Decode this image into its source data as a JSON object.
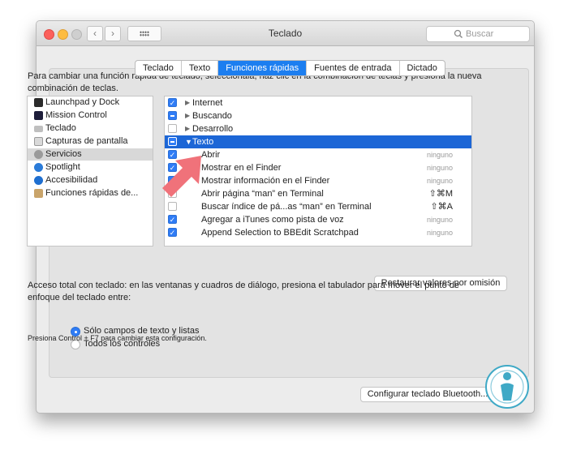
{
  "window": {
    "title": "Teclado"
  },
  "toolbar": {
    "back_glyph": "‹",
    "forward_glyph": "›"
  },
  "search": {
    "placeholder": "Buscar"
  },
  "tabs": [
    {
      "label": "Teclado",
      "active": false
    },
    {
      "label": "Texto",
      "active": false
    },
    {
      "label": "Funciones rápidas",
      "active": true
    },
    {
      "label": "Fuentes de entrada",
      "active": false
    },
    {
      "label": "Dictado",
      "active": false
    }
  ],
  "intro_text": "Para cambiar una función rápida de teclado, selecciónala, haz clic en la combinación de teclas y presiona la nueva combinación de teclas.",
  "categories": [
    {
      "label": "Launchpad y Dock",
      "icon": "launchpad-dock-icon",
      "selected": false
    },
    {
      "label": "Mission Control",
      "icon": "mission-control-icon",
      "selected": false
    },
    {
      "label": "Teclado",
      "icon": "keyboard-icon",
      "selected": false
    },
    {
      "label": "Capturas de pantalla",
      "icon": "screenshot-icon",
      "selected": false
    },
    {
      "label": "Servicios",
      "icon": "services-gear-icon",
      "selected": true
    },
    {
      "label": "Spotlight",
      "icon": "spotlight-icon",
      "selected": false
    },
    {
      "label": "Accesibilidad",
      "icon": "accessibility-icon",
      "selected": false
    },
    {
      "label": "Funciones rápidas de...",
      "icon": "app-shortcuts-icon",
      "selected": false
    }
  ],
  "services": [
    {
      "label": "Internet",
      "state": "checked",
      "disclosure": "▶",
      "shortcut": "",
      "group": true,
      "selected": false
    },
    {
      "label": "Buscando",
      "state": "mixed",
      "disclosure": "▶",
      "shortcut": "",
      "group": true,
      "selected": false
    },
    {
      "label": "Desarrollo",
      "state": "unchecked",
      "disclosure": "▶",
      "shortcut": "",
      "group": true,
      "selected": false
    },
    {
      "label": "Texto",
      "state": "mixed",
      "disclosure": "▼",
      "shortcut": "",
      "group": true,
      "selected": true
    },
    {
      "label": "Abrir",
      "state": "checked",
      "shortcut": "ninguno",
      "group": false,
      "selected": false
    },
    {
      "label": "Mostrar en el Finder",
      "state": "checked",
      "shortcut": "ninguno",
      "group": false,
      "selected": false
    },
    {
      "label": "Mostrar información en el Finder",
      "state": "checked",
      "shortcut": "ninguno",
      "group": false,
      "selected": false
    },
    {
      "label": "Abrir página “man” en Terminal",
      "state": "unchecked",
      "shortcut": "⇧⌘M",
      "group": false,
      "selected": false
    },
    {
      "label": "Buscar índice de pá...as “man” en Terminal",
      "state": "unchecked",
      "shortcut": "⇧⌘A",
      "group": false,
      "selected": false
    },
    {
      "label": "Agregar a iTunes como pista de voz",
      "state": "checked",
      "shortcut": "ninguno",
      "group": false,
      "selected": false
    },
    {
      "label": "Append Selection to BBEdit Scratchpad",
      "state": "checked",
      "shortcut": "ninguno",
      "group": false,
      "selected": false
    }
  ],
  "restore_button": "Restaurar valores por omisión",
  "access_text": "Acceso total con teclado: en las ventanas y cuadros de diálogo, presiona el tabulador para mover el punto de enfoque del teclado entre:",
  "radio_options": [
    {
      "label": "Sólo campos de texto y listas",
      "selected": true
    },
    {
      "label": "Todos los controles",
      "selected": false
    }
  ],
  "hint": "Presiona Control + F7 para cambiar esta configuración.",
  "bluetooth_button": "Configurar teclado Bluetooth...",
  "colors": {
    "accent": "#1c7ef0",
    "selection": "#1c66d6",
    "arrow": "#f0727a",
    "logo": "#3fa9c6"
  }
}
